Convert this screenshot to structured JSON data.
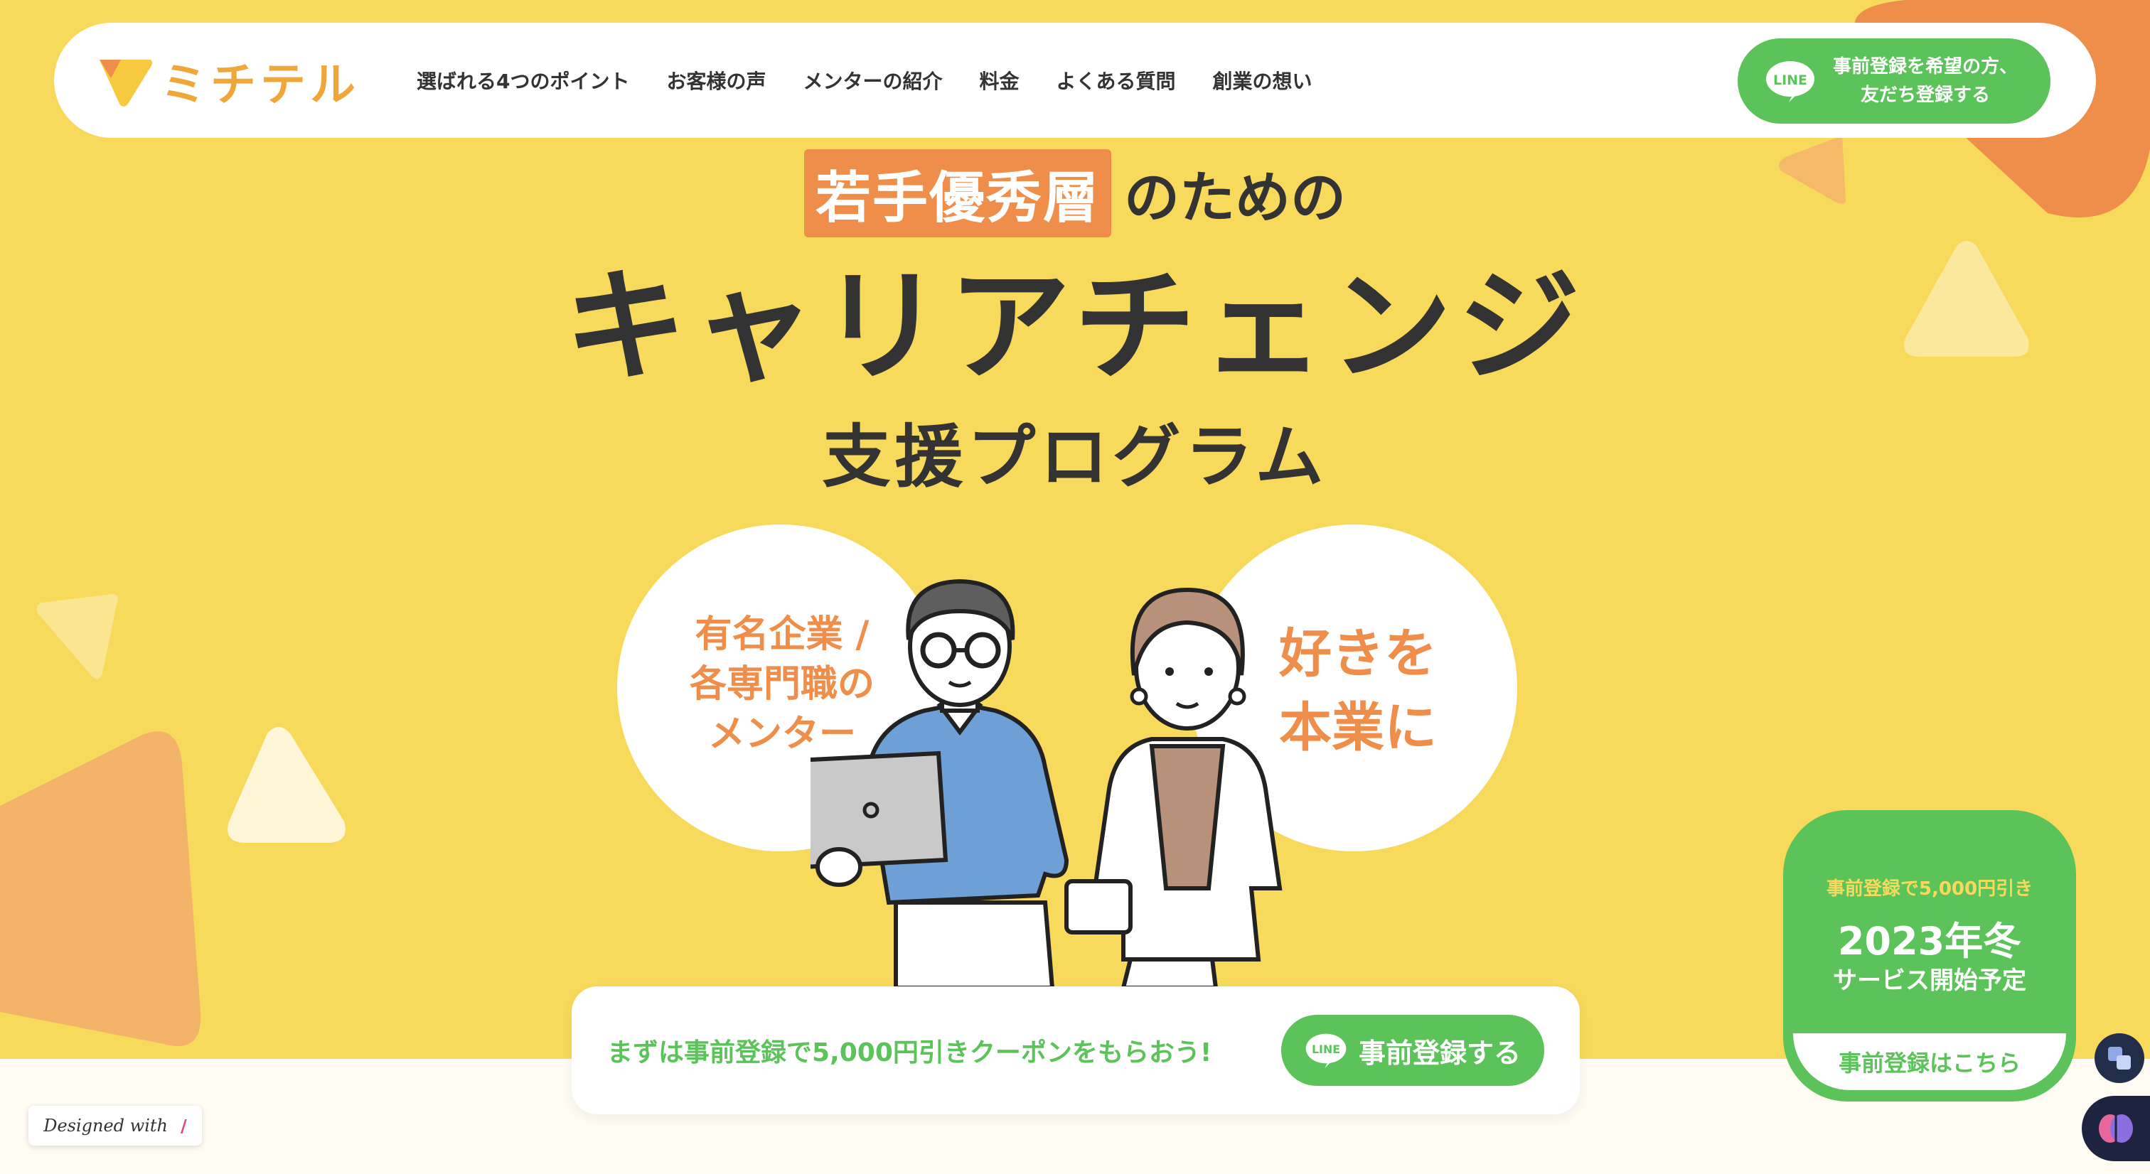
{
  "brand": {
    "name": "ミチテル"
  },
  "nav": {
    "items": [
      {
        "label": "選ばれる4つのポイント"
      },
      {
        "label": "お客様の声"
      },
      {
        "label": "メンターの紹介"
      },
      {
        "label": "料金"
      },
      {
        "label": "よくある質問"
      },
      {
        "label": "創業の想い"
      }
    ]
  },
  "header_cta": {
    "line_label": "LINE",
    "line1": "事前登録を希望の方、",
    "line2": "友だち登録する"
  },
  "hero": {
    "highlight": "若手優秀層",
    "tagline_rest": "のための",
    "title": "キャリアチェンジ",
    "subtitle": "支援プログラム",
    "bubble_left": "有名企業 /\n各専門職の\nメンター",
    "bubble_right": "好きを\n本業に"
  },
  "coupon": {
    "text": "まずは事前登録で5,000円引きクーポンをもらおう!",
    "button_label": "事前登録する",
    "line_label": "LINE"
  },
  "side_card": {
    "small": "事前登録で5,000円引き",
    "big": "2023年冬",
    "mid": "サービス開始予定",
    "button_label": "事前登録はこちら"
  },
  "footer_badge": {
    "label": "Designed with"
  },
  "colors": {
    "background": "#F7DA5B",
    "accent_orange": "#EE8E4A",
    "line_green": "#5CC35A",
    "logo_yellow": "#F0A73A"
  }
}
